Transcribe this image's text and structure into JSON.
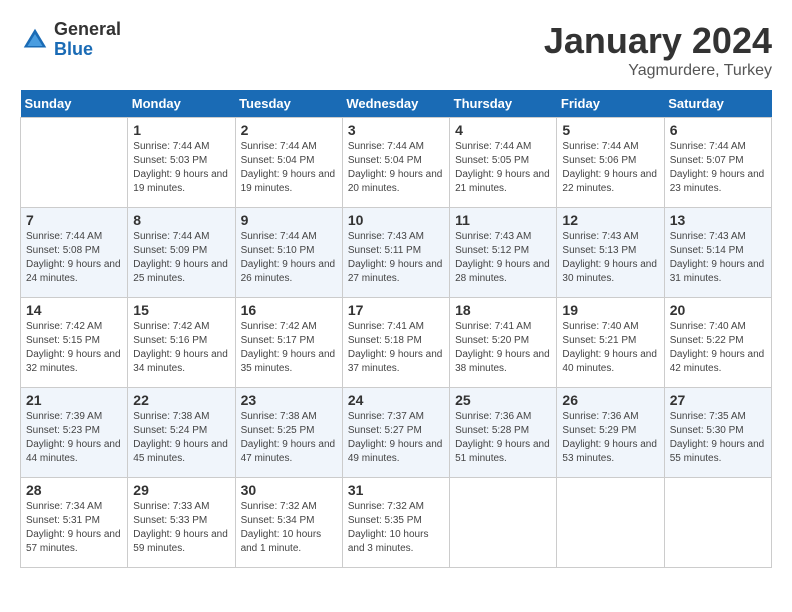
{
  "header": {
    "logo_general": "General",
    "logo_blue": "Blue",
    "month": "January 2024",
    "location": "Yagmurdere, Turkey"
  },
  "days_of_week": [
    "Sunday",
    "Monday",
    "Tuesday",
    "Wednesday",
    "Thursday",
    "Friday",
    "Saturday"
  ],
  "weeks": [
    [
      {
        "day": "",
        "info": ""
      },
      {
        "day": "1",
        "info": "Sunrise: 7:44 AM\nSunset: 5:03 PM\nDaylight: 9 hours and 19 minutes."
      },
      {
        "day": "2",
        "info": "Sunrise: 7:44 AM\nSunset: 5:04 PM\nDaylight: 9 hours and 19 minutes."
      },
      {
        "day": "3",
        "info": "Sunrise: 7:44 AM\nSunset: 5:04 PM\nDaylight: 9 hours and 20 minutes."
      },
      {
        "day": "4",
        "info": "Sunrise: 7:44 AM\nSunset: 5:05 PM\nDaylight: 9 hours and 21 minutes."
      },
      {
        "day": "5",
        "info": "Sunrise: 7:44 AM\nSunset: 5:06 PM\nDaylight: 9 hours and 22 minutes."
      },
      {
        "day": "6",
        "info": "Sunrise: 7:44 AM\nSunset: 5:07 PM\nDaylight: 9 hours and 23 minutes."
      }
    ],
    [
      {
        "day": "7",
        "info": "Sunrise: 7:44 AM\nSunset: 5:08 PM\nDaylight: 9 hours and 24 minutes."
      },
      {
        "day": "8",
        "info": "Sunrise: 7:44 AM\nSunset: 5:09 PM\nDaylight: 9 hours and 25 minutes."
      },
      {
        "day": "9",
        "info": "Sunrise: 7:44 AM\nSunset: 5:10 PM\nDaylight: 9 hours and 26 minutes."
      },
      {
        "day": "10",
        "info": "Sunrise: 7:43 AM\nSunset: 5:11 PM\nDaylight: 9 hours and 27 minutes."
      },
      {
        "day": "11",
        "info": "Sunrise: 7:43 AM\nSunset: 5:12 PM\nDaylight: 9 hours and 28 minutes."
      },
      {
        "day": "12",
        "info": "Sunrise: 7:43 AM\nSunset: 5:13 PM\nDaylight: 9 hours and 30 minutes."
      },
      {
        "day": "13",
        "info": "Sunrise: 7:43 AM\nSunset: 5:14 PM\nDaylight: 9 hours and 31 minutes."
      }
    ],
    [
      {
        "day": "14",
        "info": "Sunrise: 7:42 AM\nSunset: 5:15 PM\nDaylight: 9 hours and 32 minutes."
      },
      {
        "day": "15",
        "info": "Sunrise: 7:42 AM\nSunset: 5:16 PM\nDaylight: 9 hours and 34 minutes."
      },
      {
        "day": "16",
        "info": "Sunrise: 7:42 AM\nSunset: 5:17 PM\nDaylight: 9 hours and 35 minutes."
      },
      {
        "day": "17",
        "info": "Sunrise: 7:41 AM\nSunset: 5:18 PM\nDaylight: 9 hours and 37 minutes."
      },
      {
        "day": "18",
        "info": "Sunrise: 7:41 AM\nSunset: 5:20 PM\nDaylight: 9 hours and 38 minutes."
      },
      {
        "day": "19",
        "info": "Sunrise: 7:40 AM\nSunset: 5:21 PM\nDaylight: 9 hours and 40 minutes."
      },
      {
        "day": "20",
        "info": "Sunrise: 7:40 AM\nSunset: 5:22 PM\nDaylight: 9 hours and 42 minutes."
      }
    ],
    [
      {
        "day": "21",
        "info": "Sunrise: 7:39 AM\nSunset: 5:23 PM\nDaylight: 9 hours and 44 minutes."
      },
      {
        "day": "22",
        "info": "Sunrise: 7:38 AM\nSunset: 5:24 PM\nDaylight: 9 hours and 45 minutes."
      },
      {
        "day": "23",
        "info": "Sunrise: 7:38 AM\nSunset: 5:25 PM\nDaylight: 9 hours and 47 minutes."
      },
      {
        "day": "24",
        "info": "Sunrise: 7:37 AM\nSunset: 5:27 PM\nDaylight: 9 hours and 49 minutes."
      },
      {
        "day": "25",
        "info": "Sunrise: 7:36 AM\nSunset: 5:28 PM\nDaylight: 9 hours and 51 minutes."
      },
      {
        "day": "26",
        "info": "Sunrise: 7:36 AM\nSunset: 5:29 PM\nDaylight: 9 hours and 53 minutes."
      },
      {
        "day": "27",
        "info": "Sunrise: 7:35 AM\nSunset: 5:30 PM\nDaylight: 9 hours and 55 minutes."
      }
    ],
    [
      {
        "day": "28",
        "info": "Sunrise: 7:34 AM\nSunset: 5:31 PM\nDaylight: 9 hours and 57 minutes."
      },
      {
        "day": "29",
        "info": "Sunrise: 7:33 AM\nSunset: 5:33 PM\nDaylight: 9 hours and 59 minutes."
      },
      {
        "day": "30",
        "info": "Sunrise: 7:32 AM\nSunset: 5:34 PM\nDaylight: 10 hours and 1 minute."
      },
      {
        "day": "31",
        "info": "Sunrise: 7:32 AM\nSunset: 5:35 PM\nDaylight: 10 hours and 3 minutes."
      },
      {
        "day": "",
        "info": ""
      },
      {
        "day": "",
        "info": ""
      },
      {
        "day": "",
        "info": ""
      }
    ]
  ]
}
